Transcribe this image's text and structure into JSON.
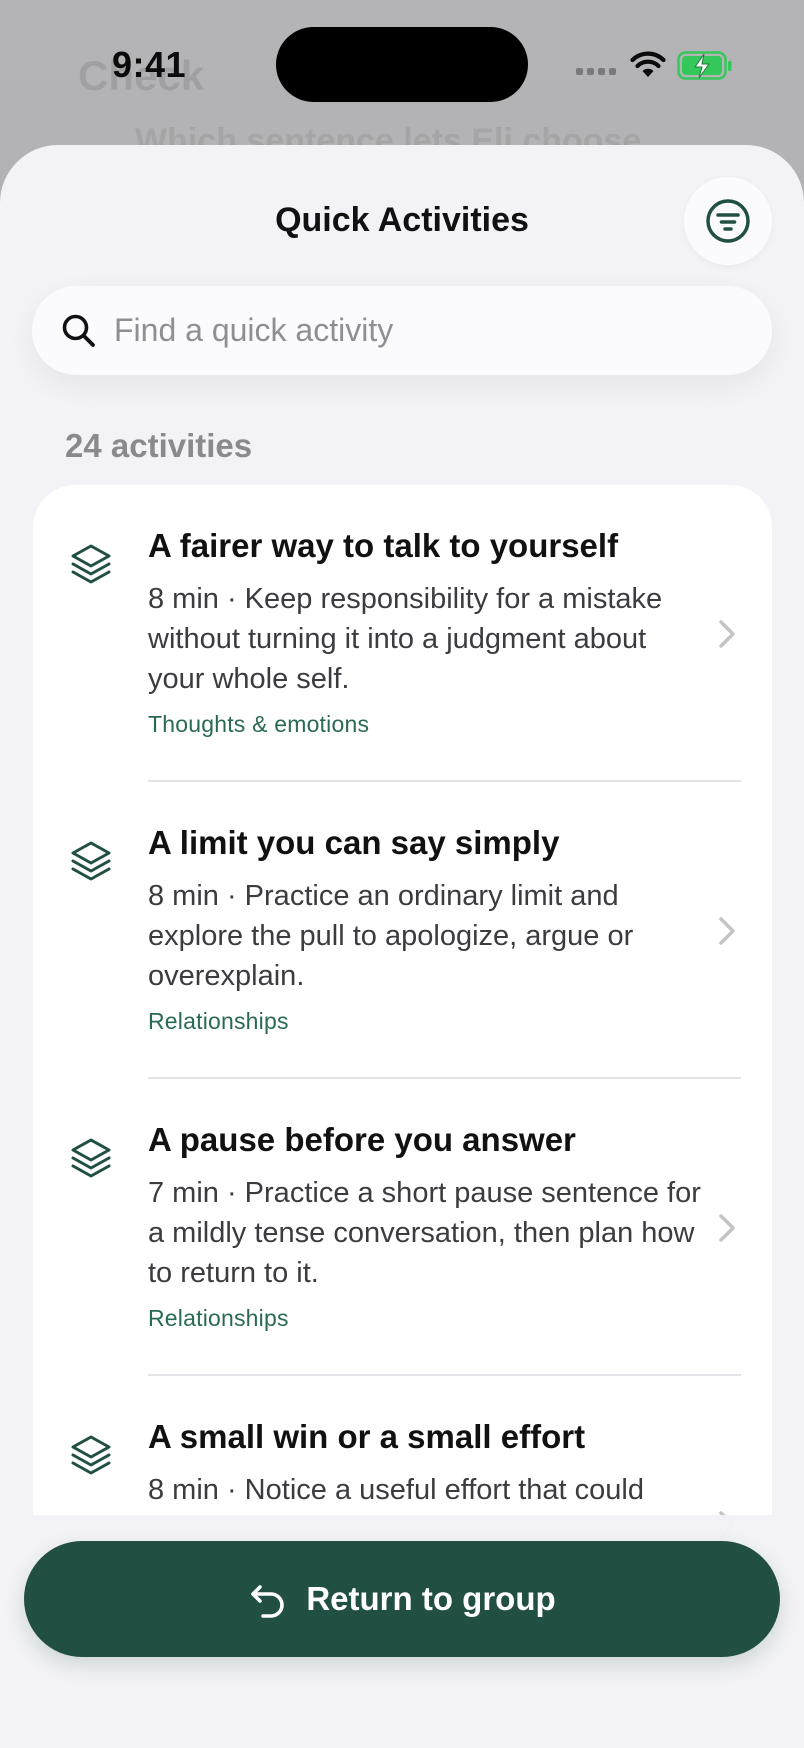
{
  "background": {
    "ghost_title": "Check",
    "ghost_subtitle": "Which sentence lets Eli choose"
  },
  "status_bar": {
    "time": "9:41",
    "icons": [
      "cellular-signal-icon",
      "wifi-icon",
      "battery-charging-icon"
    ]
  },
  "sheet": {
    "title": "Quick Activities",
    "filter_icon": "filter-icon"
  },
  "search": {
    "icon": "search-icon",
    "placeholder": "Find a quick activity",
    "value": ""
  },
  "activity_count": "24 activities",
  "activities": [
    {
      "icon": "layers-icon",
      "title": "A fairer way to talk to yourself",
      "description": "8 min · Keep responsibility for a mistake without turning it into a judgment about your whole self.",
      "category": "Thoughts & emotions"
    },
    {
      "icon": "layers-icon",
      "title": "A limit you can say simply",
      "description": "8 min · Practice an ordinary limit and explore the pull to apologize, argue or overexplain.",
      "category": "Relationships"
    },
    {
      "icon": "layers-icon",
      "title": "A pause before you answer",
      "description": "7 min · Practice a short pause sentence for a mildly tense conversation, then plan how to return to it.",
      "category": "Relationships"
    },
    {
      "icon": "layers-icon",
      "title": "A small win or a small effort",
      "description": "8 min · Notice a useful effort that could",
      "category": ""
    }
  ],
  "footer": {
    "button_label": "Return to group",
    "button_icon": "return-arrow-icon"
  },
  "colors": {
    "accent": "#224f44",
    "category_text": "#2a6a54",
    "sheet_bg": "#f2f2f7",
    "card_bg": "#ffffff",
    "battery_green": "#34c759"
  }
}
